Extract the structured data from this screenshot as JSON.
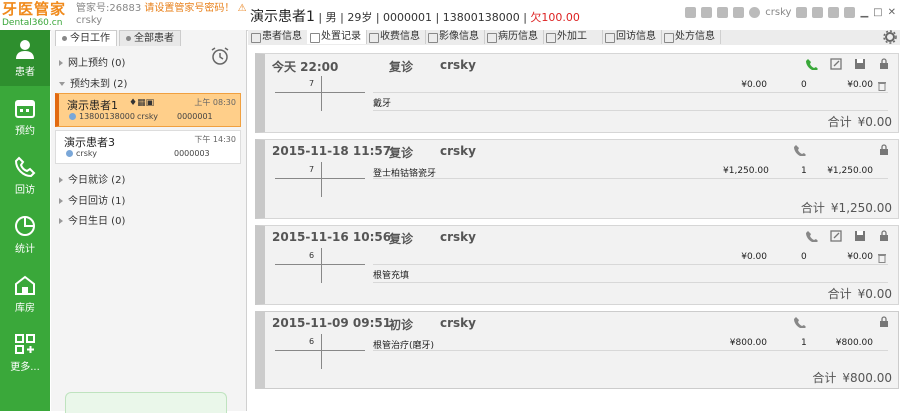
{
  "app": {
    "logo_cn": "牙医管家",
    "logo_en": "Dental360.cn",
    "account_no": "管家号:26883",
    "password_warning": "请设置管家号密码！",
    "username": "crsky"
  },
  "patient": {
    "name": "演示患者1",
    "sex": "男",
    "age": "29岁",
    "id": "0000001",
    "phone": "13800138000",
    "owe": "欠100.00"
  },
  "toolbar_right": {
    "user": "crsky"
  },
  "nav": [
    {
      "label": "患者",
      "icon": "user-icon"
    },
    {
      "label": "预约",
      "icon": "calendar-icon"
    },
    {
      "label": "回访",
      "icon": "phone-icon"
    },
    {
      "label": "统计",
      "icon": "pie-chart-icon"
    },
    {
      "label": "库房",
      "icon": "warehouse-icon"
    },
    {
      "label": "更多...",
      "icon": "grid-icon"
    }
  ],
  "left_tabs": [
    "今日工作",
    "全部患者"
  ],
  "groups": {
    "online": "网上预约 (0)",
    "unarrived": "预约未到 (2)",
    "visit": "今日就诊 (2)",
    "followup": "今日回访 (1)",
    "birthday": "今日生日 (0)"
  },
  "cards": [
    {
      "name": "演示患者1",
      "time": "上午 08:30",
      "phone": "13800138000",
      "doctor": "crsky",
      "no": "0000001"
    },
    {
      "name": "演示患者3",
      "time": "下午 14:30",
      "phone": "",
      "doctor": "crsky",
      "no": "0000003"
    }
  ],
  "tabs": [
    "患者信息",
    "处置记录",
    "收费信息",
    "影像信息",
    "病历信息",
    "外加工",
    "回访信息",
    "处方信息"
  ],
  "records": [
    {
      "date": "今天  22:00",
      "type": "复诊",
      "doctor": "crsky",
      "tooth": "7",
      "item": "戴牙",
      "price": "¥0.00",
      "qty": "0",
      "amount": "¥0.00",
      "total_label": "合计",
      "total": "¥0.00"
    },
    {
      "date": "2015-11-18  11:57",
      "type": "复诊",
      "doctor": "crsky",
      "tooth": "7",
      "item": "登士柏钴铬瓷牙",
      "price": "¥1,250.00",
      "qty": "1",
      "amount": "¥1,250.00",
      "total_label": "合计",
      "total": "¥1,250.00"
    },
    {
      "date": "2015-11-16  10:56",
      "type": "复诊",
      "doctor": "crsky",
      "tooth": "6",
      "item": "根管充填",
      "price": "¥0.00",
      "qty": "0",
      "amount": "¥0.00",
      "total_label": "合计",
      "total": "¥0.00"
    },
    {
      "date": "2015-11-09  09:51",
      "type": "初诊",
      "doctor": "crsky",
      "tooth": "6",
      "item": "根管治疗(磨牙)",
      "price": "¥800.00",
      "qty": "1",
      "amount": "¥800.00",
      "total_label": "合计",
      "total": "¥800.00"
    }
  ],
  "colors": {
    "brand_green": "#3aa83a",
    "logo_orange": "#f08a1c",
    "owe_red": "#dd2222",
    "selected_card": "#ffcf8a"
  }
}
